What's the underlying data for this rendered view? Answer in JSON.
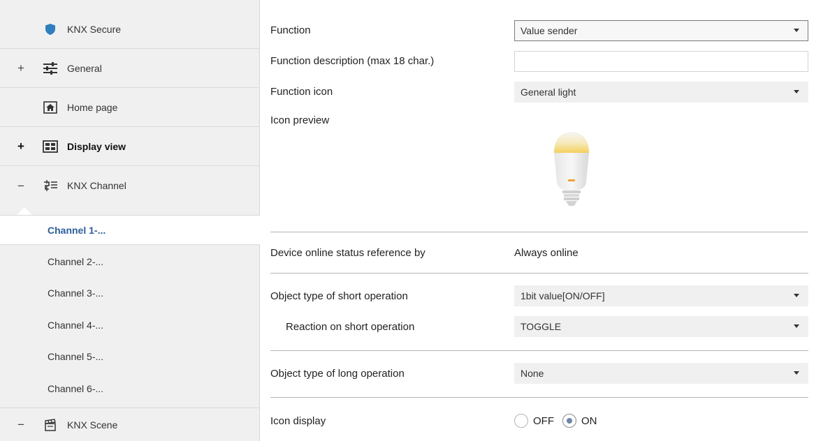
{
  "sidebar": {
    "items": [
      {
        "label": "KNX Secure",
        "toggle": "",
        "icon": "shield-icon"
      },
      {
        "label": "General",
        "toggle": "+",
        "icon": "sliders-icon"
      },
      {
        "label": "Home page",
        "toggle": "",
        "icon": "home-icon"
      },
      {
        "label": "Display view",
        "toggle": "+",
        "icon": "display-grid-icon"
      },
      {
        "label": "KNX Channel",
        "toggle": "−",
        "icon": "channel-icon"
      },
      {
        "label": "KNX Scene",
        "toggle": "−",
        "icon": "scene-clapper-icon"
      }
    ],
    "channels": [
      "Channel 1-...",
      "Channel 2-...",
      "Channel 3-...",
      "Channel 4-...",
      "Channel 5-...",
      "Channel 6-..."
    ],
    "active_channel_index": 0
  },
  "main": {
    "function": {
      "label": "Function",
      "value": "Value sender"
    },
    "function_description": {
      "label": "Function description (max 18 char.)",
      "value": ""
    },
    "function_icon": {
      "label": "Function icon",
      "value": "General light"
    },
    "icon_preview": {
      "label": "Icon preview",
      "icon": "light-bulb-icon"
    },
    "online_status": {
      "label": "Device online status reference by",
      "value": "Always online"
    },
    "short_op_type": {
      "label": "Object type of short operation",
      "value": "1bit value[ON/OFF]"
    },
    "short_op_reaction": {
      "label": "Reaction on short operation",
      "value": "TOGGLE"
    },
    "long_op_type": {
      "label": "Object type of long operation",
      "value": "None"
    },
    "icon_display": {
      "label": "Icon display",
      "options": [
        "OFF",
        "ON"
      ],
      "selected": "ON"
    }
  },
  "colors": {
    "accent": "#2a5ea8",
    "shield": "#2f7fc0",
    "sidebar_bg": "#f0f0f0"
  }
}
